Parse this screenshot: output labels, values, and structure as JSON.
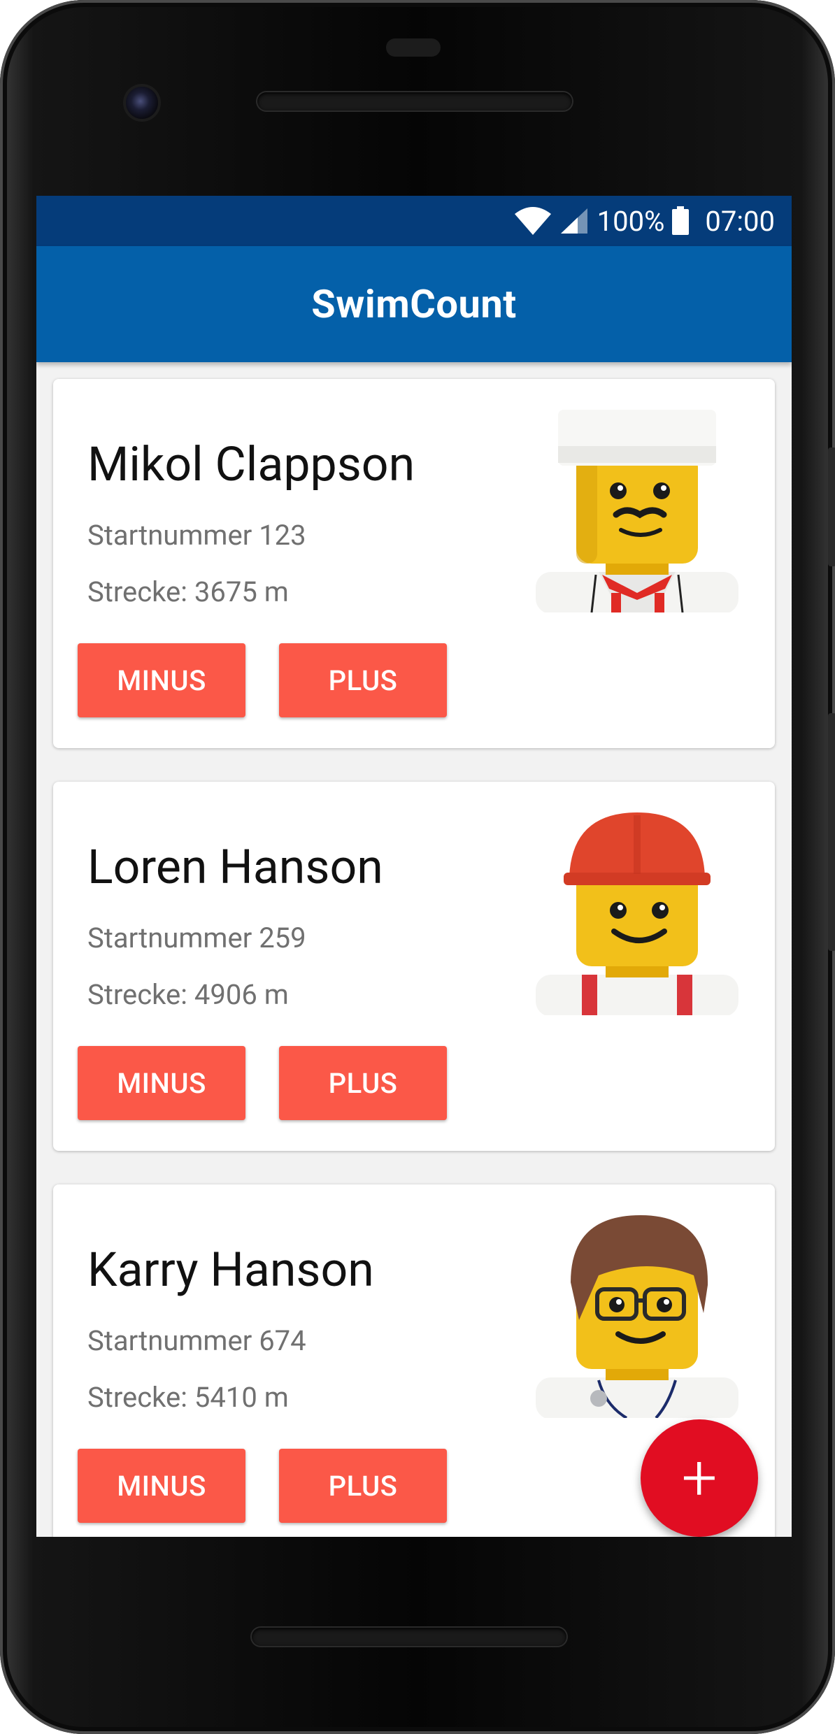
{
  "status_bar": {
    "battery": "100%",
    "time": "07:00"
  },
  "app_bar": {
    "title": "SwimCount"
  },
  "swimmers": [
    {
      "name": "Mikol Clappson",
      "number": "Startnummer 123",
      "distance": "Strecke: 3675 m",
      "minus_label": "MINUS",
      "plus_label": "PLUS",
      "avatar": "lego-chef-icon"
    },
    {
      "name": "Loren Hanson",
      "number": "Startnummer 259",
      "distance": "Strecke: 4906 m",
      "minus_label": "MINUS",
      "plus_label": "PLUS",
      "avatar": "lego-builder-icon"
    },
    {
      "name": "Karry Hanson",
      "number": "Startnummer 674",
      "distance": "Strecke: 5410 m",
      "minus_label": "MINUS",
      "plus_label": "PLUS",
      "avatar": "lego-doctor-icon"
    }
  ],
  "fab": {
    "label": "+",
    "icon": "add-icon"
  },
  "colors": {
    "status_bar": "#053c7a",
    "app_bar": "#0460a9",
    "button": "#fb5848",
    "fab": "#e10d22"
  }
}
